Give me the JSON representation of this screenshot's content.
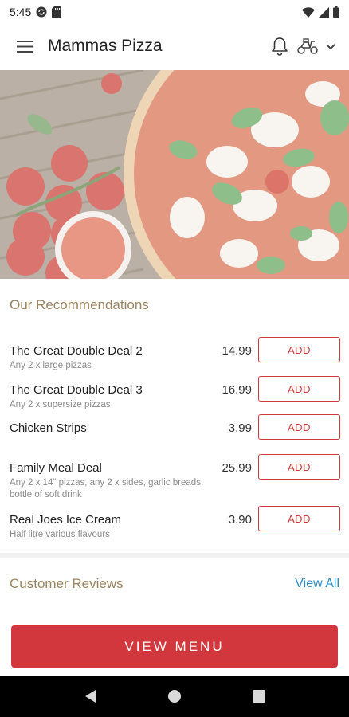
{
  "status_bar": {
    "time": "5:45"
  },
  "app_bar": {
    "title": "Mammas Pizza"
  },
  "recommendations": {
    "title": "Our Recommendations",
    "items": [
      {
        "name": "The Great Double Deal 2",
        "description": "Any 2 x large pizzas",
        "price": "14.99",
        "button": "ADD"
      },
      {
        "name": "The Great Double Deal 3",
        "description": "Any 2 x supersize pizzas",
        "price": "16.99",
        "button": "ADD"
      },
      {
        "name": "Chicken Strips",
        "description": "",
        "price": "3.99",
        "button": "ADD"
      },
      {
        "name": "Family Meal Deal",
        "description": "Any 2 x 14\" pizzas, any 2 x sides, garlic breads, bottle of soft drink",
        "price": "25.99",
        "button": "ADD"
      },
      {
        "name": "Real Joes Ice Cream",
        "description": "Half litre various flavours",
        "price": "3.90",
        "button": "ADD"
      }
    ]
  },
  "reviews": {
    "title": "Customer Reviews",
    "view_all": "View All"
  },
  "cta": {
    "label": "VIEW MENU"
  },
  "colors": {
    "accent_red": "#d1373c",
    "section_gold": "#9a835e",
    "link_blue": "#2a8fc6"
  }
}
